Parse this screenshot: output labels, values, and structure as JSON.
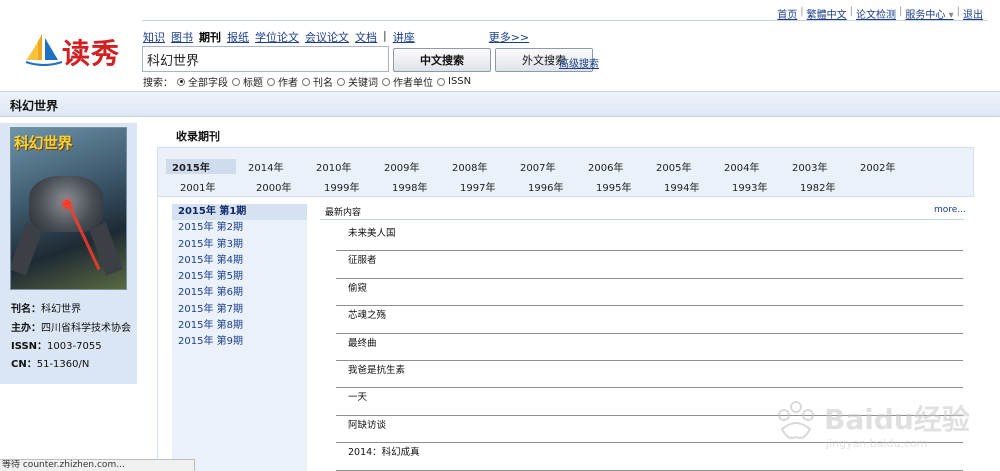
{
  "top_links": [
    "首页",
    "繁體中文",
    "论文检测",
    "服务中心",
    "退出"
  ],
  "logo": {
    "text": "读秀"
  },
  "categories": [
    {
      "label": "知识",
      "active": false
    },
    {
      "label": "图书",
      "active": false
    },
    {
      "label": "期刊",
      "active": true
    },
    {
      "label": "报纸",
      "active": false
    },
    {
      "label": "学位论文",
      "active": false
    },
    {
      "label": "会议论文",
      "active": false
    },
    {
      "label": "文档",
      "active": false
    },
    {
      "label": "讲座",
      "active": false
    }
  ],
  "more_label": "更多>>",
  "search": {
    "value": "科幻世界"
  },
  "buttons": {
    "chinese": "中文搜索",
    "foreign": "外文搜索",
    "advanced": "高级搜索"
  },
  "scope": {
    "label": "搜索：",
    "options": [
      "全部字段",
      "标题",
      "作者",
      "刊名",
      "关键词",
      "作者单位",
      "ISSN"
    ],
    "selected": 0
  },
  "page_title": "科幻世界",
  "journal": {
    "cover_title": "科幻世界",
    "fields": [
      {
        "label": "刊名：",
        "value": "科幻世界"
      },
      {
        "label": "主办：",
        "value": "四川省科学技术协会"
      },
      {
        "label": "ISSN：",
        "value": "1003-7055"
      },
      {
        "label": "CN：",
        "value": "51-1360/N"
      }
    ]
  },
  "section_title": "收录期刊",
  "years_row1": [
    "2015年",
    "2014年",
    "2010年",
    "2009年",
    "2008年",
    "2007年",
    "2006年",
    "2005年",
    "2004年",
    "2003年",
    "2002年"
  ],
  "years_row2": [
    "2001年",
    "2000年",
    "1999年",
    "1998年",
    "1997年",
    "1996年",
    "1995年",
    "1994年",
    "1993年",
    "1982年"
  ],
  "selected_year": "2015年",
  "issues": [
    "2015年 第1期",
    "2015年 第2期",
    "2015年 第3期",
    "2015年 第4期",
    "2015年 第5期",
    "2015年 第6期",
    "2015年 第7期",
    "2015年 第8期",
    "2015年 第9期"
  ],
  "selected_issue": 0,
  "latest": {
    "label": "最新内容",
    "more": "more..."
  },
  "articles": [
    "未来美人国",
    "征服者",
    "偷窥",
    "芯魂之殇",
    "最终曲",
    "我爸是抗生素",
    "一天",
    "阿缺访谈",
    "2014：科幻成真"
  ],
  "status_text": "等待 counter.zhizhen.com...",
  "watermark": {
    "main": "Baidu经验",
    "sub": "jingyan.baidu.com"
  }
}
